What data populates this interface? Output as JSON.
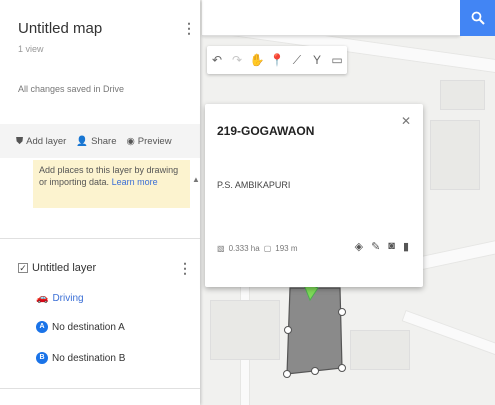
{
  "panel": {
    "title": "Untitled map",
    "views": "1 view",
    "saved_status": "All changes saved in Drive",
    "actions": {
      "add_layer": "Add layer",
      "share": "Share",
      "preview": "Preview"
    },
    "notice": {
      "text": "Add places to this layer by drawing or importing data.",
      "link": "Learn more"
    },
    "layer": {
      "title": "Untitled layer",
      "checked": true,
      "driving": "Driving",
      "destinations": [
        {
          "marker": "A",
          "label": "No destination A"
        },
        {
          "marker": "B",
          "label": "No destination B"
        }
      ]
    }
  },
  "toolbar": {
    "tools": [
      "undo-icon",
      "redo-icon",
      "hand-icon",
      "marker-icon",
      "draw-line-icon",
      "directions-icon",
      "ruler-icon"
    ]
  },
  "card": {
    "title": "219-GOGAWAON",
    "description": "P.S. AMBIKAPURI",
    "area": "0.333 ha",
    "perimeter": "193 m"
  },
  "colors": {
    "accent": "#4285f4",
    "notice_bg": "#fcf3cf",
    "polygon_fill": "#8a8a8a",
    "marker": "#7ed957"
  }
}
